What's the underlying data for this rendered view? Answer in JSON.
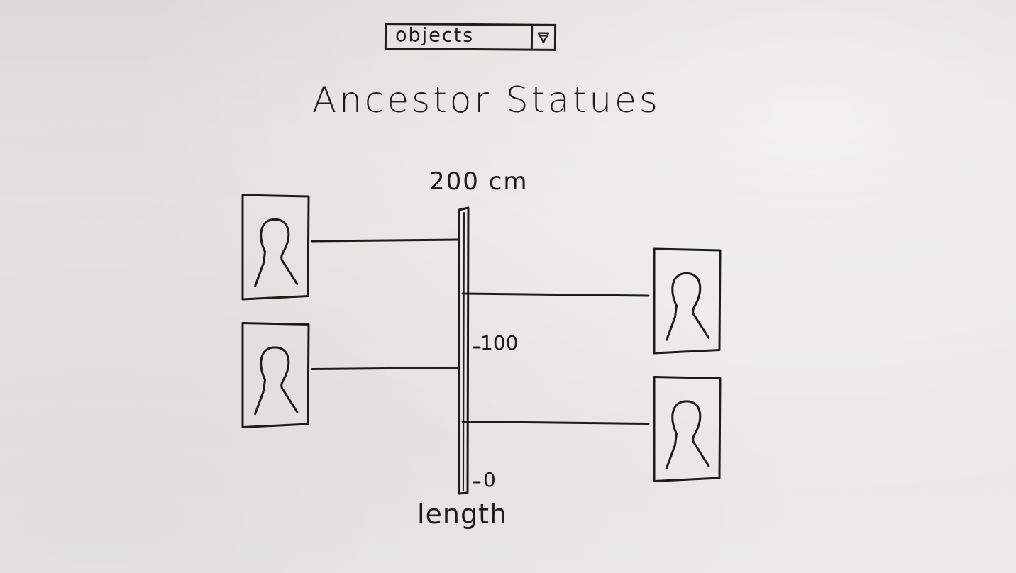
{
  "dropdown": {
    "selected": "objects"
  },
  "title": "Ancestor Statues",
  "axis": {
    "max_label": "200 cm",
    "label": "length",
    "ticks": [
      {
        "value": 100,
        "label": "100"
      },
      {
        "value": 0,
        "label": "0"
      }
    ],
    "range": [
      0,
      200
    ]
  },
  "chart_data": {
    "type": "scatter",
    "ylabel": "length",
    "ylim": [
      0,
      200
    ],
    "items": [
      {
        "side": "left",
        "length": 180,
        "icon": "statue-icon"
      },
      {
        "side": "left",
        "length": 85,
        "icon": "statue-icon"
      },
      {
        "side": "right",
        "length": 140,
        "icon": "statue-icon"
      },
      {
        "side": "right",
        "length": 45,
        "icon": "statue-icon"
      }
    ]
  },
  "colors": {
    "ink": "#1c1c1c",
    "paper": "#e6e4e1"
  }
}
